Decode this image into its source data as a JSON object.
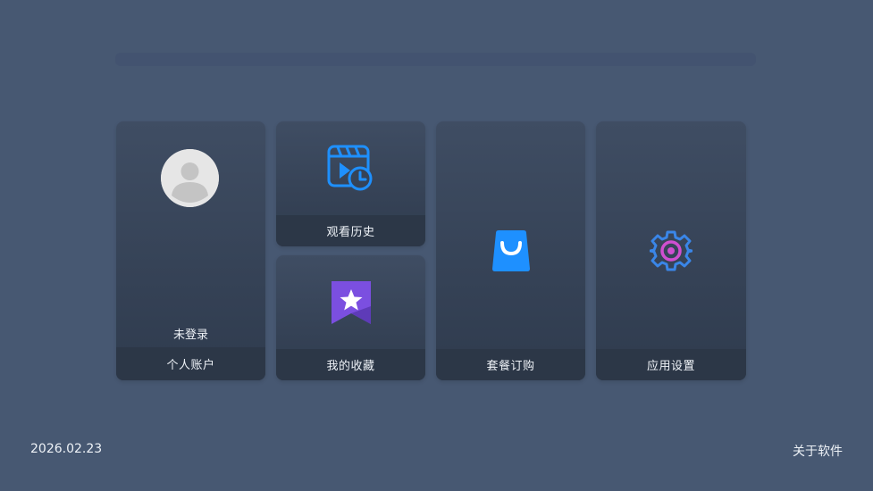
{
  "account": {
    "login_status": "未登录",
    "label": "个人账户"
  },
  "tiles": {
    "history_label": "观看历史",
    "favorites_label": "我的收藏",
    "package_label": "套餐订购",
    "settings_label": "应用设置"
  },
  "footer": {
    "date": "2026.02.23",
    "about_label": "关于软件"
  },
  "icons": {
    "avatar": "user-avatar-icon",
    "history": "clapperboard-clock-icon",
    "favorites": "star-bookmark-icon",
    "package": "shopping-bag-icon",
    "settings": "gear-icon"
  },
  "colors": {
    "background": "#475872",
    "accent_blue": "#1e90ff",
    "accent_purple": "#7b4fe0",
    "accent_pink": "#d04fd0"
  }
}
